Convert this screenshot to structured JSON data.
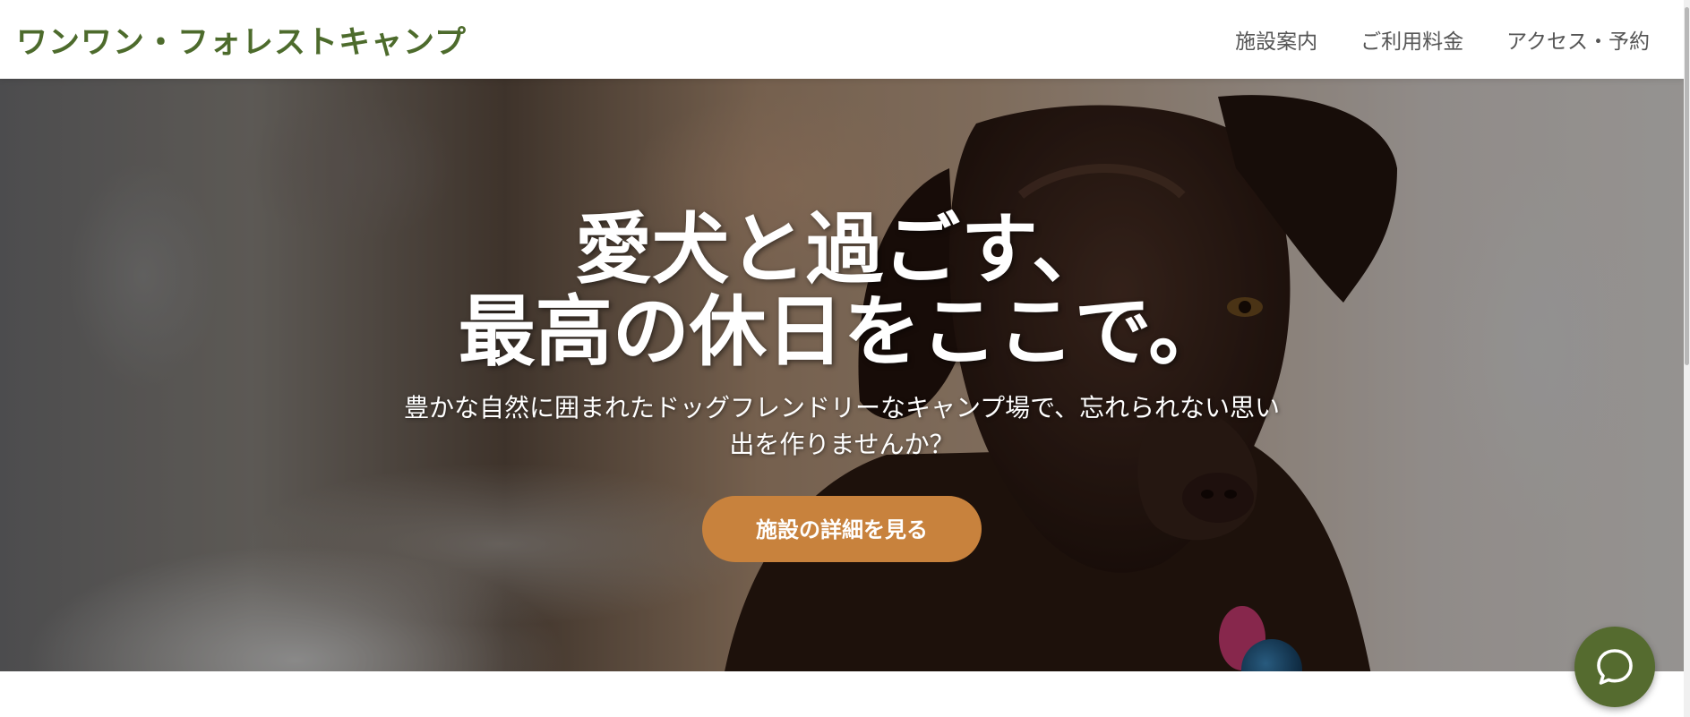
{
  "header": {
    "logo": "ワンワン・フォレストキャンプ",
    "nav": [
      {
        "label": "施設案内"
      },
      {
        "label": "ご利用料金"
      },
      {
        "label": "アクセス・予約"
      }
    ]
  },
  "hero": {
    "title_line1": "愛犬と過ごす、",
    "title_line2": "最高の休日をここで。",
    "subtitle": "豊かな自然に囲まれたドッグフレンドリーなキャンプ場で、忘れられない思い出を作りませんか？",
    "cta_label": "施設の詳細を見る",
    "image_subject": "chocolate-labrador-dog"
  },
  "chat": {
    "icon": "chat-bubble-icon"
  },
  "colors": {
    "brand_green": "#4d6b2c",
    "cta_orange": "#c8823d",
    "chat_green": "#556b2f",
    "nav_text": "#555555"
  }
}
